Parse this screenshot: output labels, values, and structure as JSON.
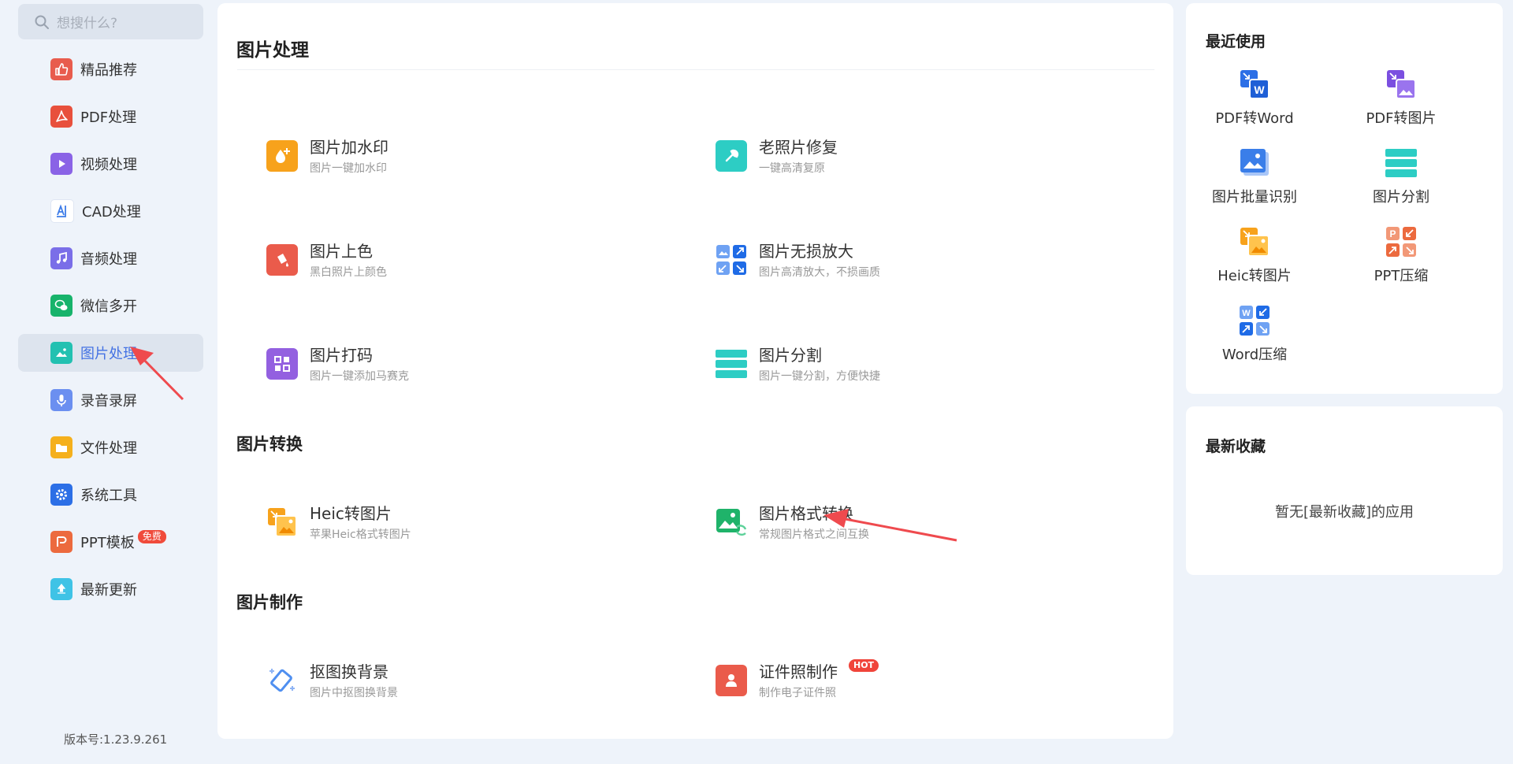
{
  "search": {
    "placeholder": "想搜什么?"
  },
  "sidebar": {
    "items": [
      {
        "label": "精品推荐",
        "icon": "thumbs-up-icon",
        "color": "#e85c4d"
      },
      {
        "label": "PDF处理",
        "icon": "pdf-icon",
        "color": "#e8503c"
      },
      {
        "label": "视频处理",
        "icon": "play-icon",
        "color": "#8a63e6"
      },
      {
        "label": "CAD处理",
        "icon": "cad-icon",
        "color": "#3d7ce8"
      },
      {
        "label": "音频处理",
        "icon": "music-icon",
        "color": "#7a6ee8"
      },
      {
        "label": "微信多开",
        "icon": "wechat-icon",
        "color": "#17b36b"
      },
      {
        "label": "图片处理",
        "icon": "image-icon",
        "color": "#23c1b1"
      },
      {
        "label": "录音录屏",
        "icon": "mic-icon",
        "color": "#6b8ff0"
      },
      {
        "label": "文件处理",
        "icon": "folder-icon",
        "color": "#f5b01c"
      },
      {
        "label": "系统工具",
        "icon": "gear-icon",
        "color": "#2c6fe6"
      },
      {
        "label": "PPT模板",
        "icon": "ppt-icon",
        "color": "#ec6a3e",
        "badge": "免费"
      },
      {
        "label": "最新更新",
        "icon": "upload-icon",
        "color": "#3fc3e6"
      }
    ],
    "active": "图片处理",
    "version": "版本号:1.23.9.261"
  },
  "main": {
    "sections": [
      {
        "title": "图片处理"
      },
      {
        "title": "图片转换"
      },
      {
        "title": "图片制作"
      }
    ],
    "tools": [
      {
        "name": "图片加水印",
        "desc": "图片一键加水印",
        "icon": "watermark-icon",
        "color": "#f7a21c"
      },
      {
        "name": "老照片修复",
        "desc": "一键高清复原",
        "icon": "repair-icon",
        "color": "#2dcdc4"
      },
      {
        "name": "图片上色",
        "desc": "黑白照片上颜色",
        "icon": "paint-bucket-icon",
        "color": "#ea5b4b"
      },
      {
        "name": "图片无损放大",
        "desc": "图片高清放大，不损画质",
        "icon": "enlarge-icon",
        "color": "#3a7ee9"
      },
      {
        "name": "图片打码",
        "desc": "图片一键添加马赛克",
        "icon": "mosaic-icon",
        "color": "#9360e0"
      },
      {
        "name": "图片分割",
        "desc": "图片一键分割，方便快捷",
        "icon": "split-icon",
        "color": "#2dcdc4"
      },
      {
        "name": "Heic转图片",
        "desc": "苹果Heic格式转图片",
        "icon": "heic-icon",
        "color": "#f7a21c"
      },
      {
        "name": "图片格式转换",
        "desc": "常规图片格式之间互换",
        "icon": "format-convert-icon",
        "color": "#1fb36a"
      },
      {
        "name": "抠图换背景",
        "desc": "图片中抠图换背景",
        "icon": "cutout-icon",
        "color": "#4f8ff0"
      },
      {
        "name": "证件照制作",
        "desc": "制作电子证件照",
        "icon": "id-photo-icon",
        "color": "#ea5b4b",
        "badge": "HOT"
      }
    ]
  },
  "recent": {
    "title": "最近使用",
    "items": [
      {
        "label": "PDF转Word",
        "icon": "pdf-to-word-icon"
      },
      {
        "label": "PDF转图片",
        "icon": "pdf-to-image-icon"
      },
      {
        "label": "图片批量识别",
        "icon": "batch-ocr-icon"
      },
      {
        "label": "图片分割",
        "icon": "split-icon"
      },
      {
        "label": "Heic转图片",
        "icon": "heic-icon"
      },
      {
        "label": "PPT压缩",
        "icon": "ppt-compress-icon"
      },
      {
        "label": "Word压缩",
        "icon": "word-compress-icon"
      }
    ]
  },
  "favorites": {
    "title": "最新收藏",
    "empty": "暂无[最新收藏]的应用"
  },
  "colors": {
    "accent": "#4472e3",
    "annotation_arrow": "#ef4a4e"
  }
}
